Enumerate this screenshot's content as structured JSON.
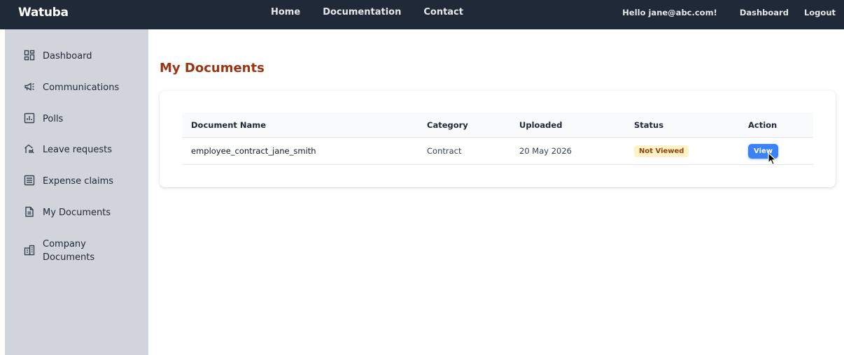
{
  "brand": "Watuba",
  "topnav": {
    "home": "Home",
    "documentation": "Documentation",
    "contact": "Contact"
  },
  "user": {
    "greeting": "Hello jane@abc.com!",
    "dashboard": "Dashboard",
    "logout": "Logout"
  },
  "sidebar": {
    "items": [
      {
        "label": "Dashboard",
        "icon": "dashboard-icon"
      },
      {
        "label": "Communications",
        "icon": "megaphone-icon"
      },
      {
        "label": "Polls",
        "icon": "poll-chart-icon"
      },
      {
        "label": "Leave requests",
        "icon": "leave-request-icon"
      },
      {
        "label": "Expense claims",
        "icon": "list-icon"
      },
      {
        "label": "My Documents",
        "icon": "document-icon"
      },
      {
        "label": "Company Documents",
        "icon": "building-icon"
      }
    ]
  },
  "page": {
    "title": "My Documents"
  },
  "table": {
    "columns": [
      "Document Name",
      "Category",
      "Uploaded",
      "Status",
      "Action"
    ],
    "rows": [
      {
        "name": "employee_contract_jane_smith",
        "category": "Contract",
        "uploaded": "20 May 2026",
        "status": "Not Viewed",
        "action": "View"
      }
    ]
  },
  "colors": {
    "topbar": "#1f2937",
    "sidebar": "#d1d5db",
    "title": "#9a3412",
    "accent": "#3b82f6",
    "badge_bg": "#fef3c7",
    "badge_text": "#92400e"
  }
}
